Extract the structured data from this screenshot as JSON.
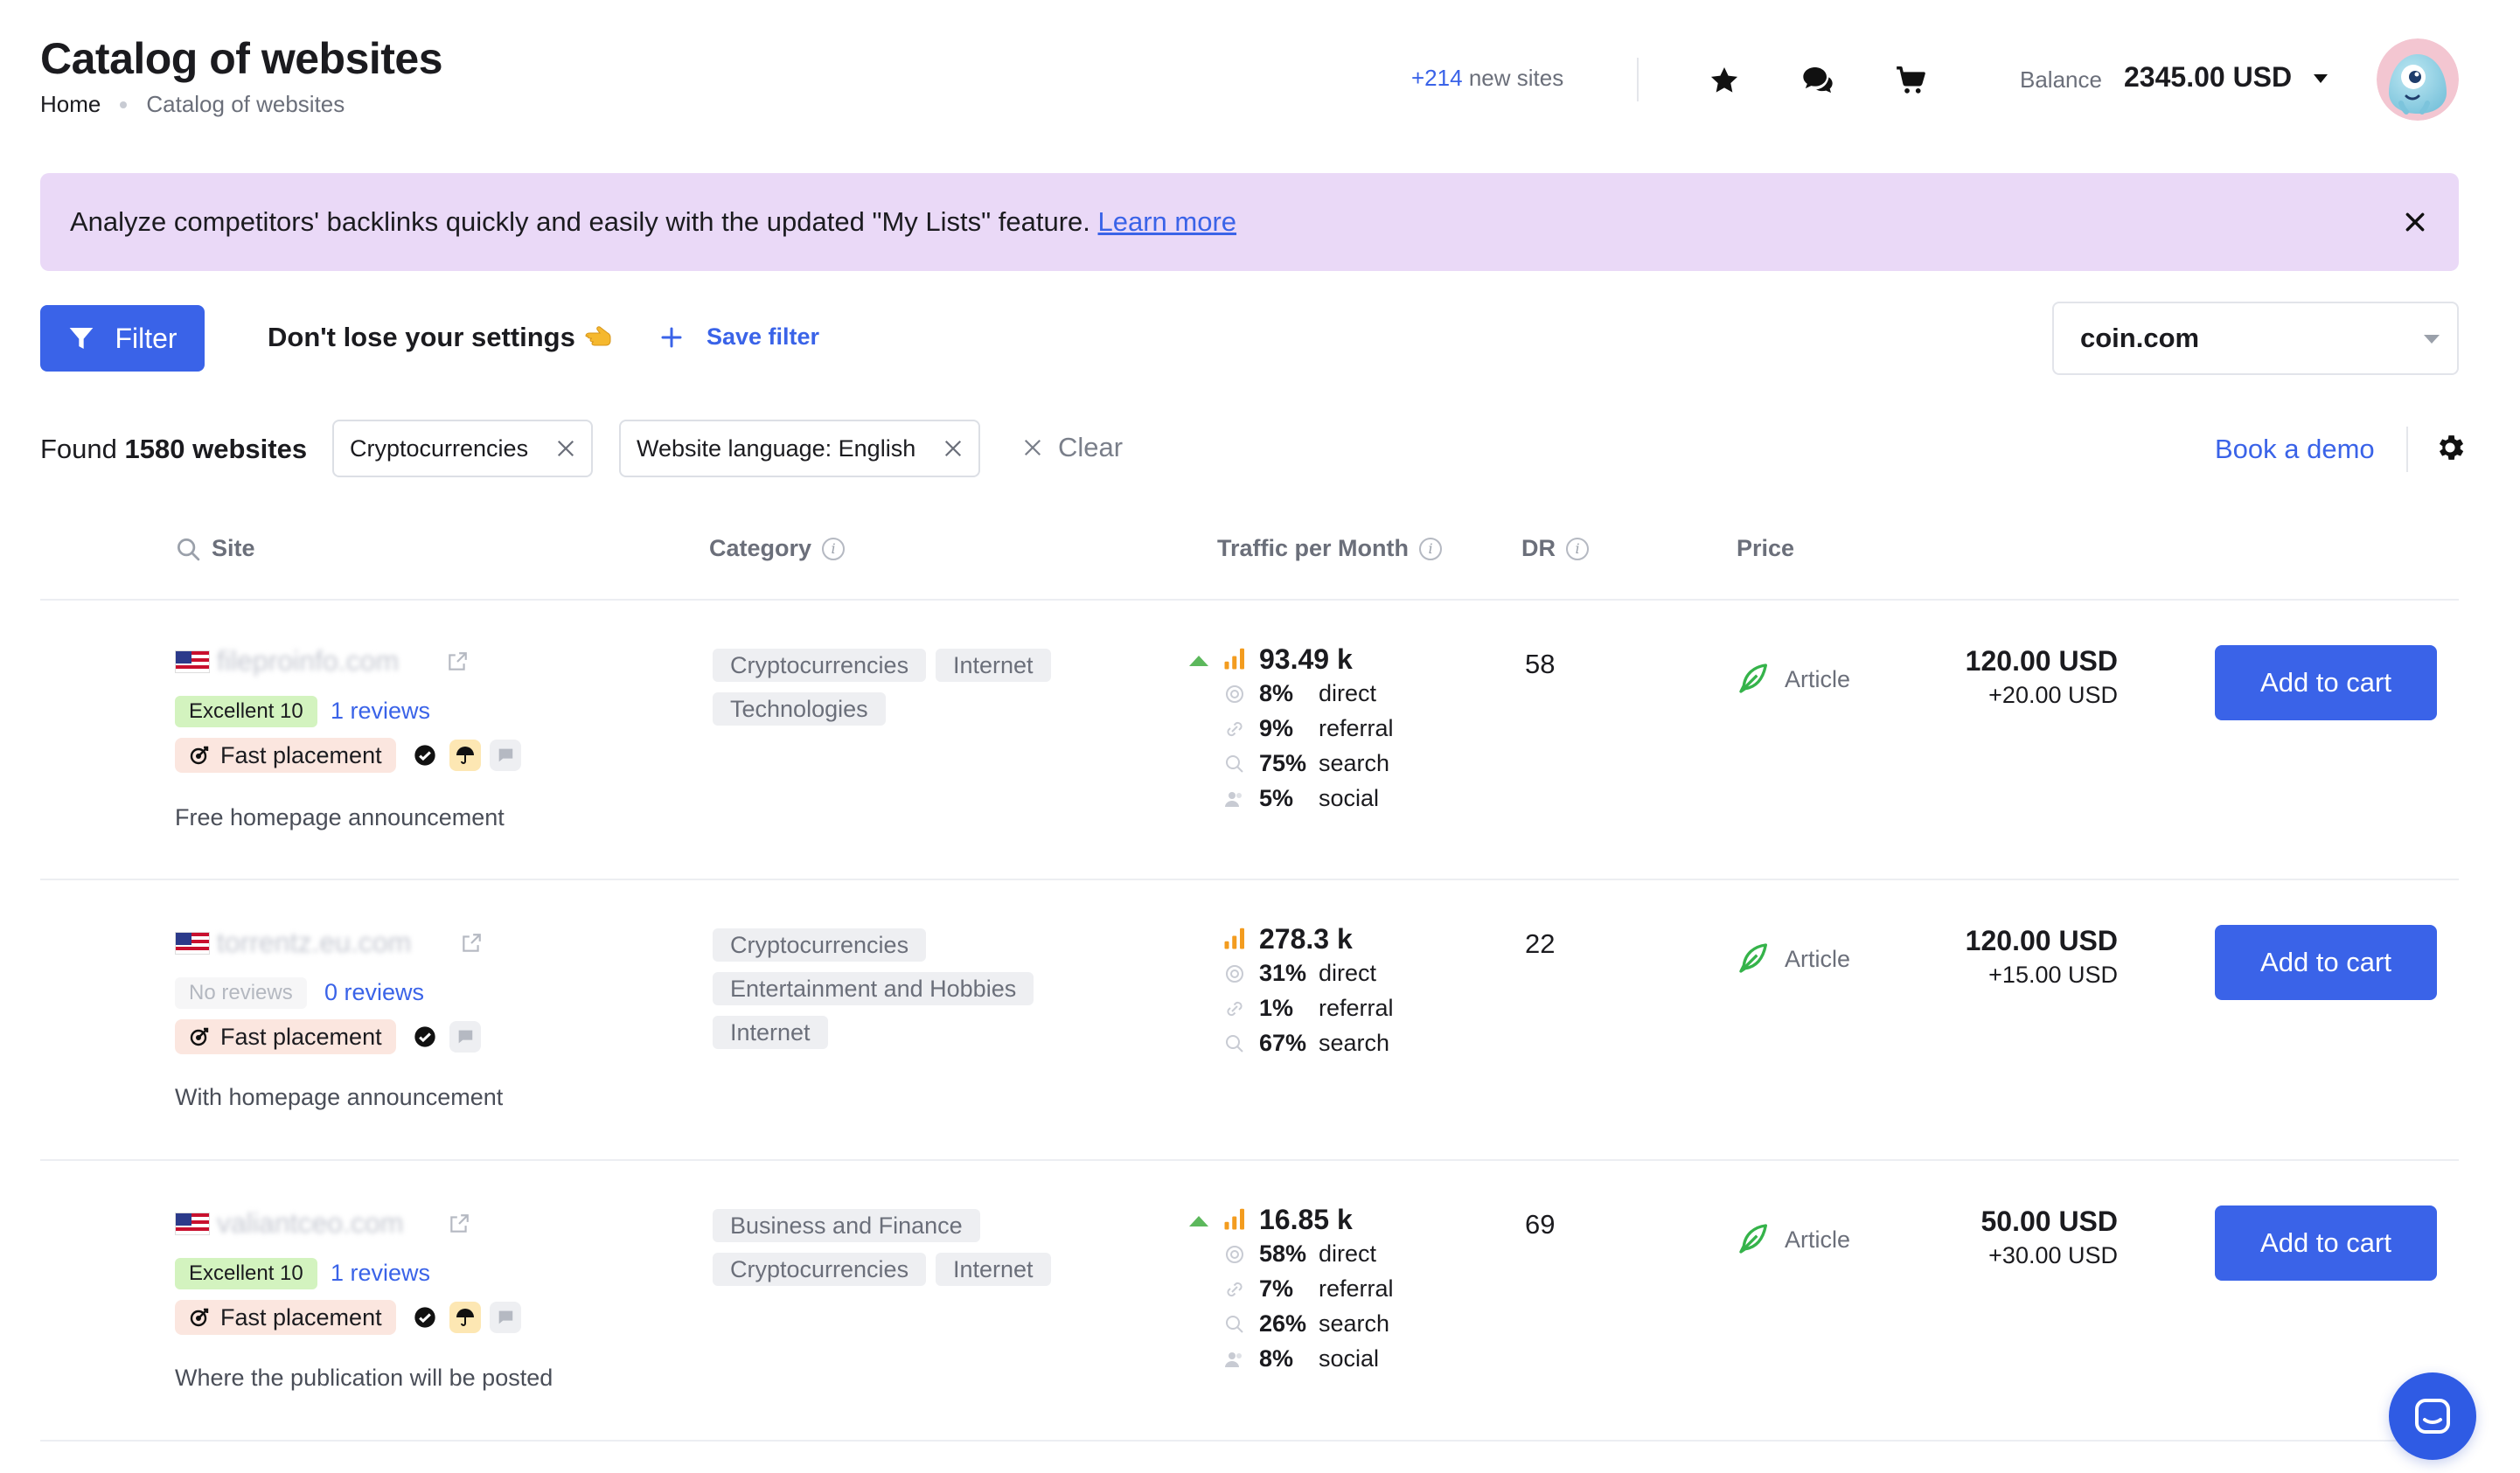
{
  "header": {
    "title": "Catalog of websites",
    "breadcrumb": [
      "Home",
      "Catalog of websites"
    ],
    "new_sites_count": "+214",
    "new_sites_label": "new sites",
    "balance_label": "Balance",
    "balance_value": "2345.00 USD"
  },
  "banner": {
    "text": "Analyze competitors' backlinks quickly and easily with the updated \"My Lists\" feature.",
    "link": "Learn more"
  },
  "toolbar": {
    "filter_label": "Filter",
    "settings_note": "Don't lose your settings",
    "save_filter": "Save filter",
    "site_select_value": "coin.com"
  },
  "results": {
    "found_prefix": "Found",
    "found_count": "1580 websites",
    "chips": [
      "Cryptocurrencies",
      "Website language: English"
    ],
    "clear_label": "Clear",
    "book_demo": "Book a demo"
  },
  "table": {
    "columns": [
      "Site",
      "Category",
      "Traffic per Month",
      "DR",
      "Price"
    ],
    "rows": [
      {
        "site": "fileproinfo.com",
        "rating": "Excellent 10",
        "reviews": "1 reviews",
        "fast": "Fast placement",
        "description": "Free homepage announcement",
        "categories": [
          "Cryptocurrencies",
          "Internet",
          "Technologies"
        ],
        "traffic": "93.49 k",
        "traffic_lines": [
          {
            "pct": "8%",
            "label": "direct"
          },
          {
            "pct": "9%",
            "label": "referral"
          },
          {
            "pct": "75%",
            "label": "search"
          },
          {
            "pct": "5%",
            "label": "social"
          }
        ],
        "dr": "58",
        "type": "Article",
        "price": "120.00 USD",
        "price_extra": "+20.00 USD",
        "button": "Add to cart"
      },
      {
        "site": "torrentz.eu.com",
        "rating": "No reviews",
        "reviews": "0 reviews",
        "fast": "Fast placement",
        "description": "With homepage announcement",
        "categories": [
          "Cryptocurrencies",
          "Entertainment and Hobbies",
          "Internet"
        ],
        "traffic": "278.3 k",
        "traffic_lines": [
          {
            "pct": "31%",
            "label": "direct"
          },
          {
            "pct": "1%",
            "label": "referral"
          },
          {
            "pct": "67%",
            "label": "search"
          }
        ],
        "dr": "22",
        "type": "Article",
        "price": "120.00 USD",
        "price_extra": "+15.00 USD",
        "button": "Add to cart"
      },
      {
        "site": "valiantceo.com",
        "rating": "Excellent 10",
        "reviews": "1 reviews",
        "fast": "Fast placement",
        "description": "Where the publication will be posted",
        "categories": [
          "Business and Finance",
          "Cryptocurrencies",
          "Internet"
        ],
        "traffic": "16.85 k",
        "traffic_lines": [
          {
            "pct": "58%",
            "label": "direct"
          },
          {
            "pct": "7%",
            "label": "referral"
          },
          {
            "pct": "26%",
            "label": "search"
          },
          {
            "pct": "8%",
            "label": "social"
          }
        ],
        "dr": "69",
        "type": "Article",
        "price": "50.00 USD",
        "price_extra": "+30.00 USD",
        "button": "Add to cart"
      }
    ]
  },
  "colors": {
    "accent": "#3a63e8",
    "banner_bg": "#ead9f7",
    "rating_good": "#d3f3bf",
    "fast_bg": "#fbe6df",
    "trend_up": "#5cb85c",
    "traffic_bars": "#f39c1f"
  },
  "icons": [
    "star-icon",
    "chat-icon",
    "cart-icon",
    "caret-down-icon",
    "close-icon",
    "filter-icon",
    "plus-icon",
    "search-icon",
    "info-icon",
    "gear-icon",
    "external-link-icon",
    "feather-icon",
    "messenger-icon"
  ]
}
